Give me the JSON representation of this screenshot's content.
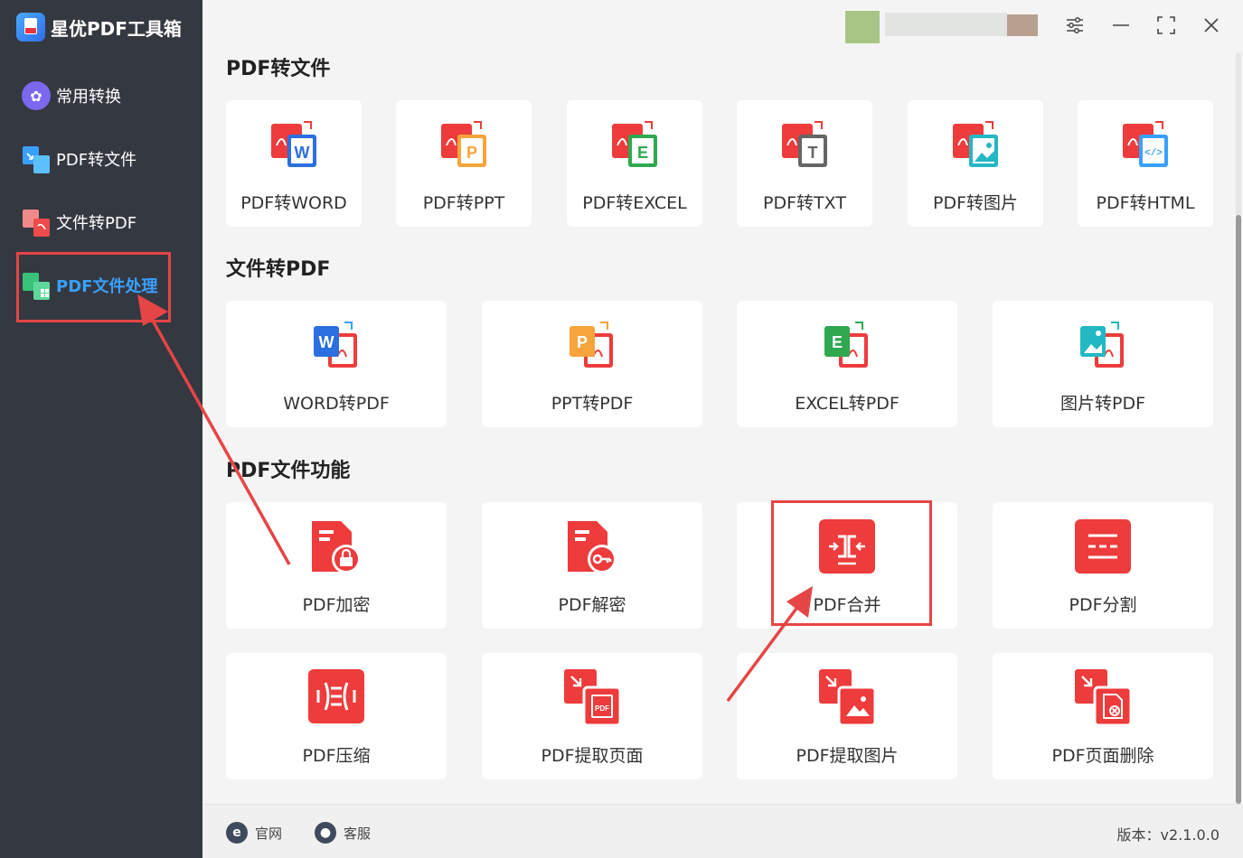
{
  "app": {
    "title": "星优PDF工具箱"
  },
  "sidebar": {
    "items": [
      {
        "label": "常用转换",
        "icon": "common-convert-icon"
      },
      {
        "label": "PDF转文件",
        "icon": "pdf-to-file-icon"
      },
      {
        "label": "文件转PDF",
        "icon": "file-to-pdf-icon"
      },
      {
        "label": "PDF文件处理",
        "icon": "pdf-process-icon",
        "active": true
      }
    ]
  },
  "window_controls": [
    "settings-icon",
    "minimize-icon",
    "maximize-icon",
    "close-icon"
  ],
  "sections": {
    "pdf_to_file": {
      "title": "PDF转文件",
      "items": [
        {
          "label": "PDF转WORD",
          "badge_letter": "W",
          "color": "#2b6fe0"
        },
        {
          "label": "PDF转PPT",
          "badge_letter": "P",
          "color": "#f7a43a"
        },
        {
          "label": "PDF转EXCEL",
          "badge_letter": "E",
          "color": "#2fa84f"
        },
        {
          "label": "PDF转TXT",
          "badge_letter": "T",
          "color": "#666666"
        },
        {
          "label": "PDF转图片",
          "badge_letter": "",
          "color": "#22b8c4"
        },
        {
          "label": "PDF转HTML",
          "badge_letter": "</>",
          "color": "#3aa0ff"
        }
      ]
    },
    "file_to_pdf": {
      "title": "文件转PDF",
      "items": [
        {
          "label": "WORD转PDF",
          "badge_letter": "W",
          "color": "#2b6fe0"
        },
        {
          "label": "PPT转PDF",
          "badge_letter": "P",
          "color": "#f7a43a"
        },
        {
          "label": "EXCEL转PDF",
          "badge_letter": "E",
          "color": "#2fa84f"
        },
        {
          "label": "图片转PDF",
          "badge_letter": "",
          "color": "#22b8c4"
        }
      ]
    },
    "pdf_functions": {
      "title": "PDF文件功能",
      "items": [
        {
          "label": "PDF加密"
        },
        {
          "label": "PDF解密"
        },
        {
          "label": "PDF合并"
        },
        {
          "label": "PDF分割"
        },
        {
          "label": "PDF压缩"
        },
        {
          "label": "PDF提取页面"
        },
        {
          "label": "PDF提取图片"
        },
        {
          "label": "PDF页面删除"
        }
      ]
    }
  },
  "footer": {
    "website": "官网",
    "support": "客服",
    "version": "版本：v2.1.0.0"
  },
  "colors": {
    "sidebar_bg": "#343841",
    "accent": "#3aa0ff",
    "brand_red": "#ee3b3b",
    "highlight": "#e64545"
  }
}
